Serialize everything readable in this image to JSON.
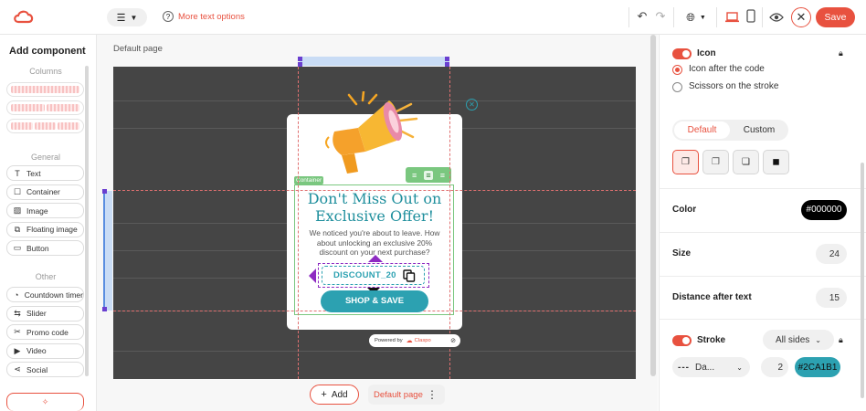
{
  "header": {
    "text_options_label": "More text options",
    "save_label": "Save"
  },
  "left_panel": {
    "title": "Add component",
    "columns_section": "Columns",
    "general_section": "General",
    "general_items": [
      {
        "label": "Text",
        "icon": "text-icon"
      },
      {
        "label": "Container",
        "icon": "container-icon"
      },
      {
        "label": "Image",
        "icon": "image-icon"
      },
      {
        "label": "Floating image",
        "icon": "floating-image-icon"
      },
      {
        "label": "Button",
        "icon": "button-icon"
      }
    ],
    "other_section": "Other",
    "other_items": [
      {
        "label": "Countdown timer",
        "icon": "countdown-icon"
      },
      {
        "label": "Slider",
        "icon": "slider-icon"
      },
      {
        "label": "Promo code",
        "icon": "promo-code-icon"
      },
      {
        "label": "Video",
        "icon": "video-icon"
      },
      {
        "label": "Social",
        "icon": "social-icon"
      }
    ]
  },
  "canvas": {
    "page_label": "Default page",
    "container_tag": "Container",
    "headline": "Don't Miss Out on Exclusive Offer!",
    "body": "We noticed you're about to leave. How about unlocking an exclusive 20% discount on your next purchase?",
    "promo_code": "DISCOUNT_20",
    "cta_label": "SHOP & SAVE",
    "powered_by": "Powered by",
    "brand": "Claspo"
  },
  "bottom_bar": {
    "add_label": "Add",
    "page_select": "Default page"
  },
  "right_panel": {
    "icon_label": "Icon",
    "icon_after_code": "Icon after the code",
    "scissors_on_stroke": "Scissors on the stroke",
    "tab_default": "Default",
    "tab_custom": "Custom",
    "color_label": "Color",
    "color_value": "#000000",
    "size_label": "Size",
    "size_value": "24",
    "distance_label": "Distance after text",
    "distance_value": "15",
    "stroke_label": "Stroke",
    "stroke_sides": "All sides",
    "stroke_style": "Da...",
    "stroke_width": "2",
    "stroke_color": "#2CA1B1"
  },
  "colors": {
    "accent": "#e8513f",
    "teal": "#2ca1b1",
    "purple": "#8e2bc2",
    "canvas_bg": "#454545"
  }
}
